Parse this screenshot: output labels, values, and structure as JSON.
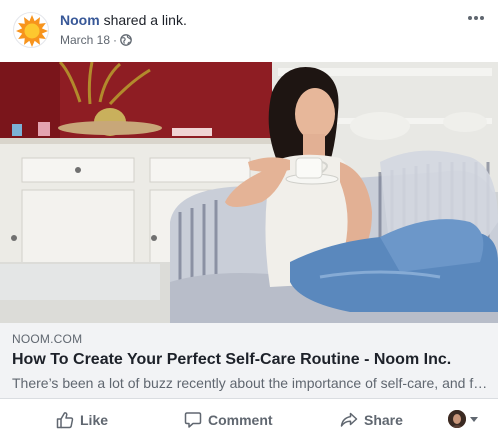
{
  "post": {
    "author": "Noom",
    "action": "shared a link.",
    "date": "March 18",
    "meta_separator": "·",
    "privacy_icon": "globe-icon",
    "menu_icon": "more-horizontal-icon"
  },
  "link": {
    "domain": "NOOM.COM",
    "title": "How To Create Your Perfect Self-Care Routine - Noom Inc.",
    "description": "There’s been a lot of buzz recently about the importance of self-care, and for good reason. Self-care is all about taking care of yourself."
  },
  "actions": {
    "like_label": "Like",
    "comment_label": "Comment",
    "share_label": "Share",
    "like_icon": "thumbs-up-icon",
    "comment_icon": "comment-bubble-icon",
    "share_icon": "share-arrow-icon"
  },
  "colors": {
    "author_link": "#385898",
    "logo_orange": "#f7941d",
    "logo_yellow": "#fdc82f",
    "caption_bg": "#f2f3f5",
    "secondary_text": "#606770"
  }
}
